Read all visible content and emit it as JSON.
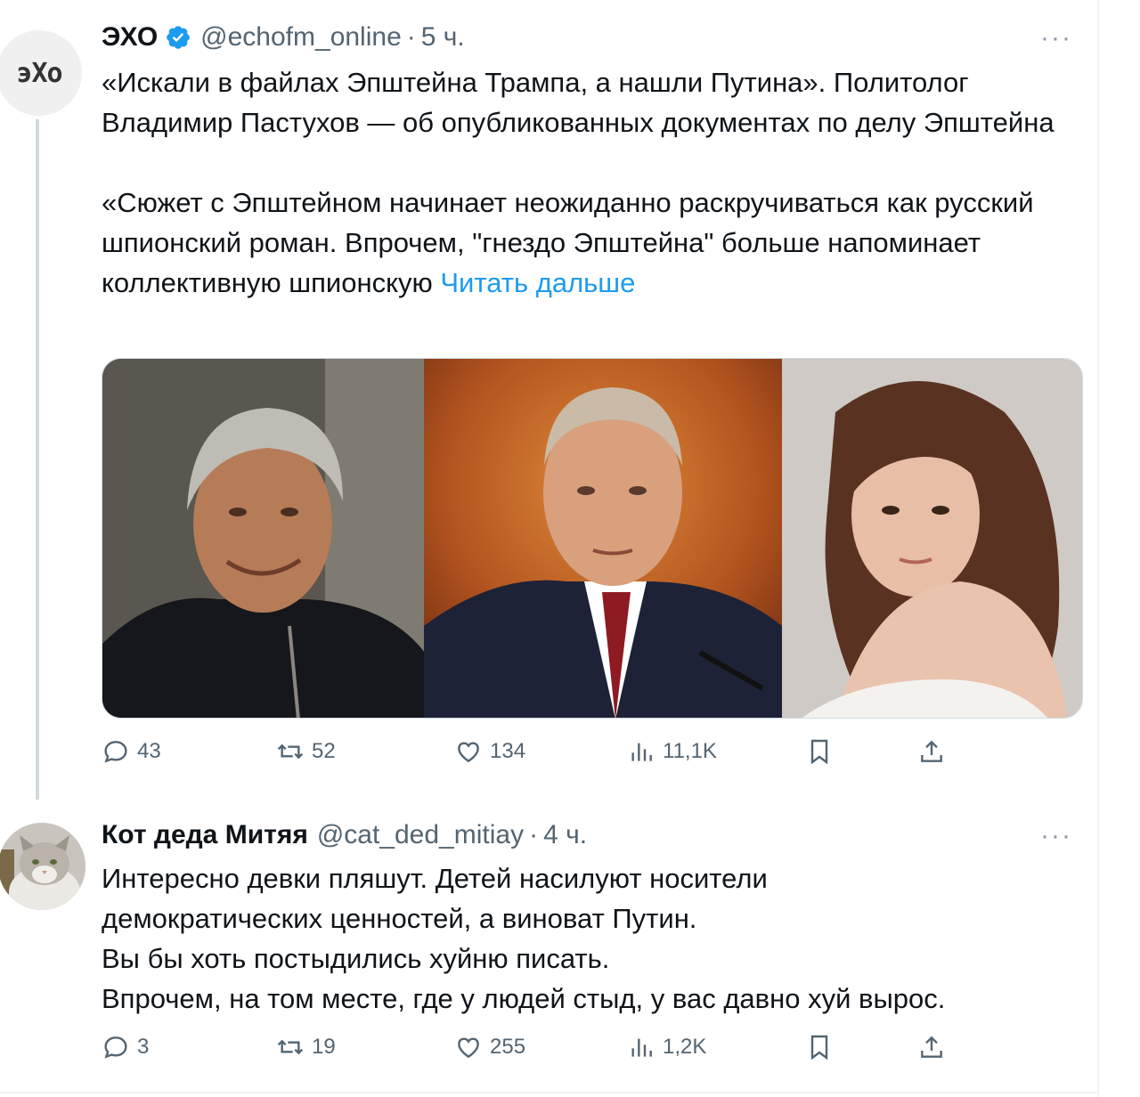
{
  "tweets": [
    {
      "author_name": "ЭХО",
      "handle": "@echofm_online",
      "time": "5 ч.",
      "avatar_text": "эХо",
      "verified": true,
      "paragraph1": "«Искали в файлах Эпштейна Трампа, а нашли Путина». Политолог Владимир Пастухов — об опубликованных документах по делу Эпштейна",
      "paragraph2": "«Сюжет с Эпштейном начинает неожиданно раскручиваться как русский шпионский роман. Впрочем, \"гнездо Эпштейна\" больше напоминает коллективную шпионскую",
      "read_more": "Читать дальше",
      "stats": {
        "replies": "43",
        "reposts": "52",
        "likes": "134",
        "views": "11,1K"
      }
    },
    {
      "author_name": "Кот деда Митяя",
      "handle": "@cat_ded_mitiay",
      "time": "4 ч.",
      "lines": [
        "Интересно девки пляшут. Детей насилуют носители",
        "демократических ценностей, а виноват Путин.",
        "Вы бы хоть постыдились хуйню писать.",
        "Впрочем, на том месте, где у людей стыд, у вас давно хуй вырос."
      ],
      "stats": {
        "replies": "3",
        "reposts": "19",
        "likes": "255",
        "views": "1,2K"
      }
    }
  ],
  "more_label": "···",
  "dot_sep": "·",
  "colors": {
    "link": "#1d9bf0",
    "muted": "#536471",
    "verified": "#1d9bf0"
  }
}
